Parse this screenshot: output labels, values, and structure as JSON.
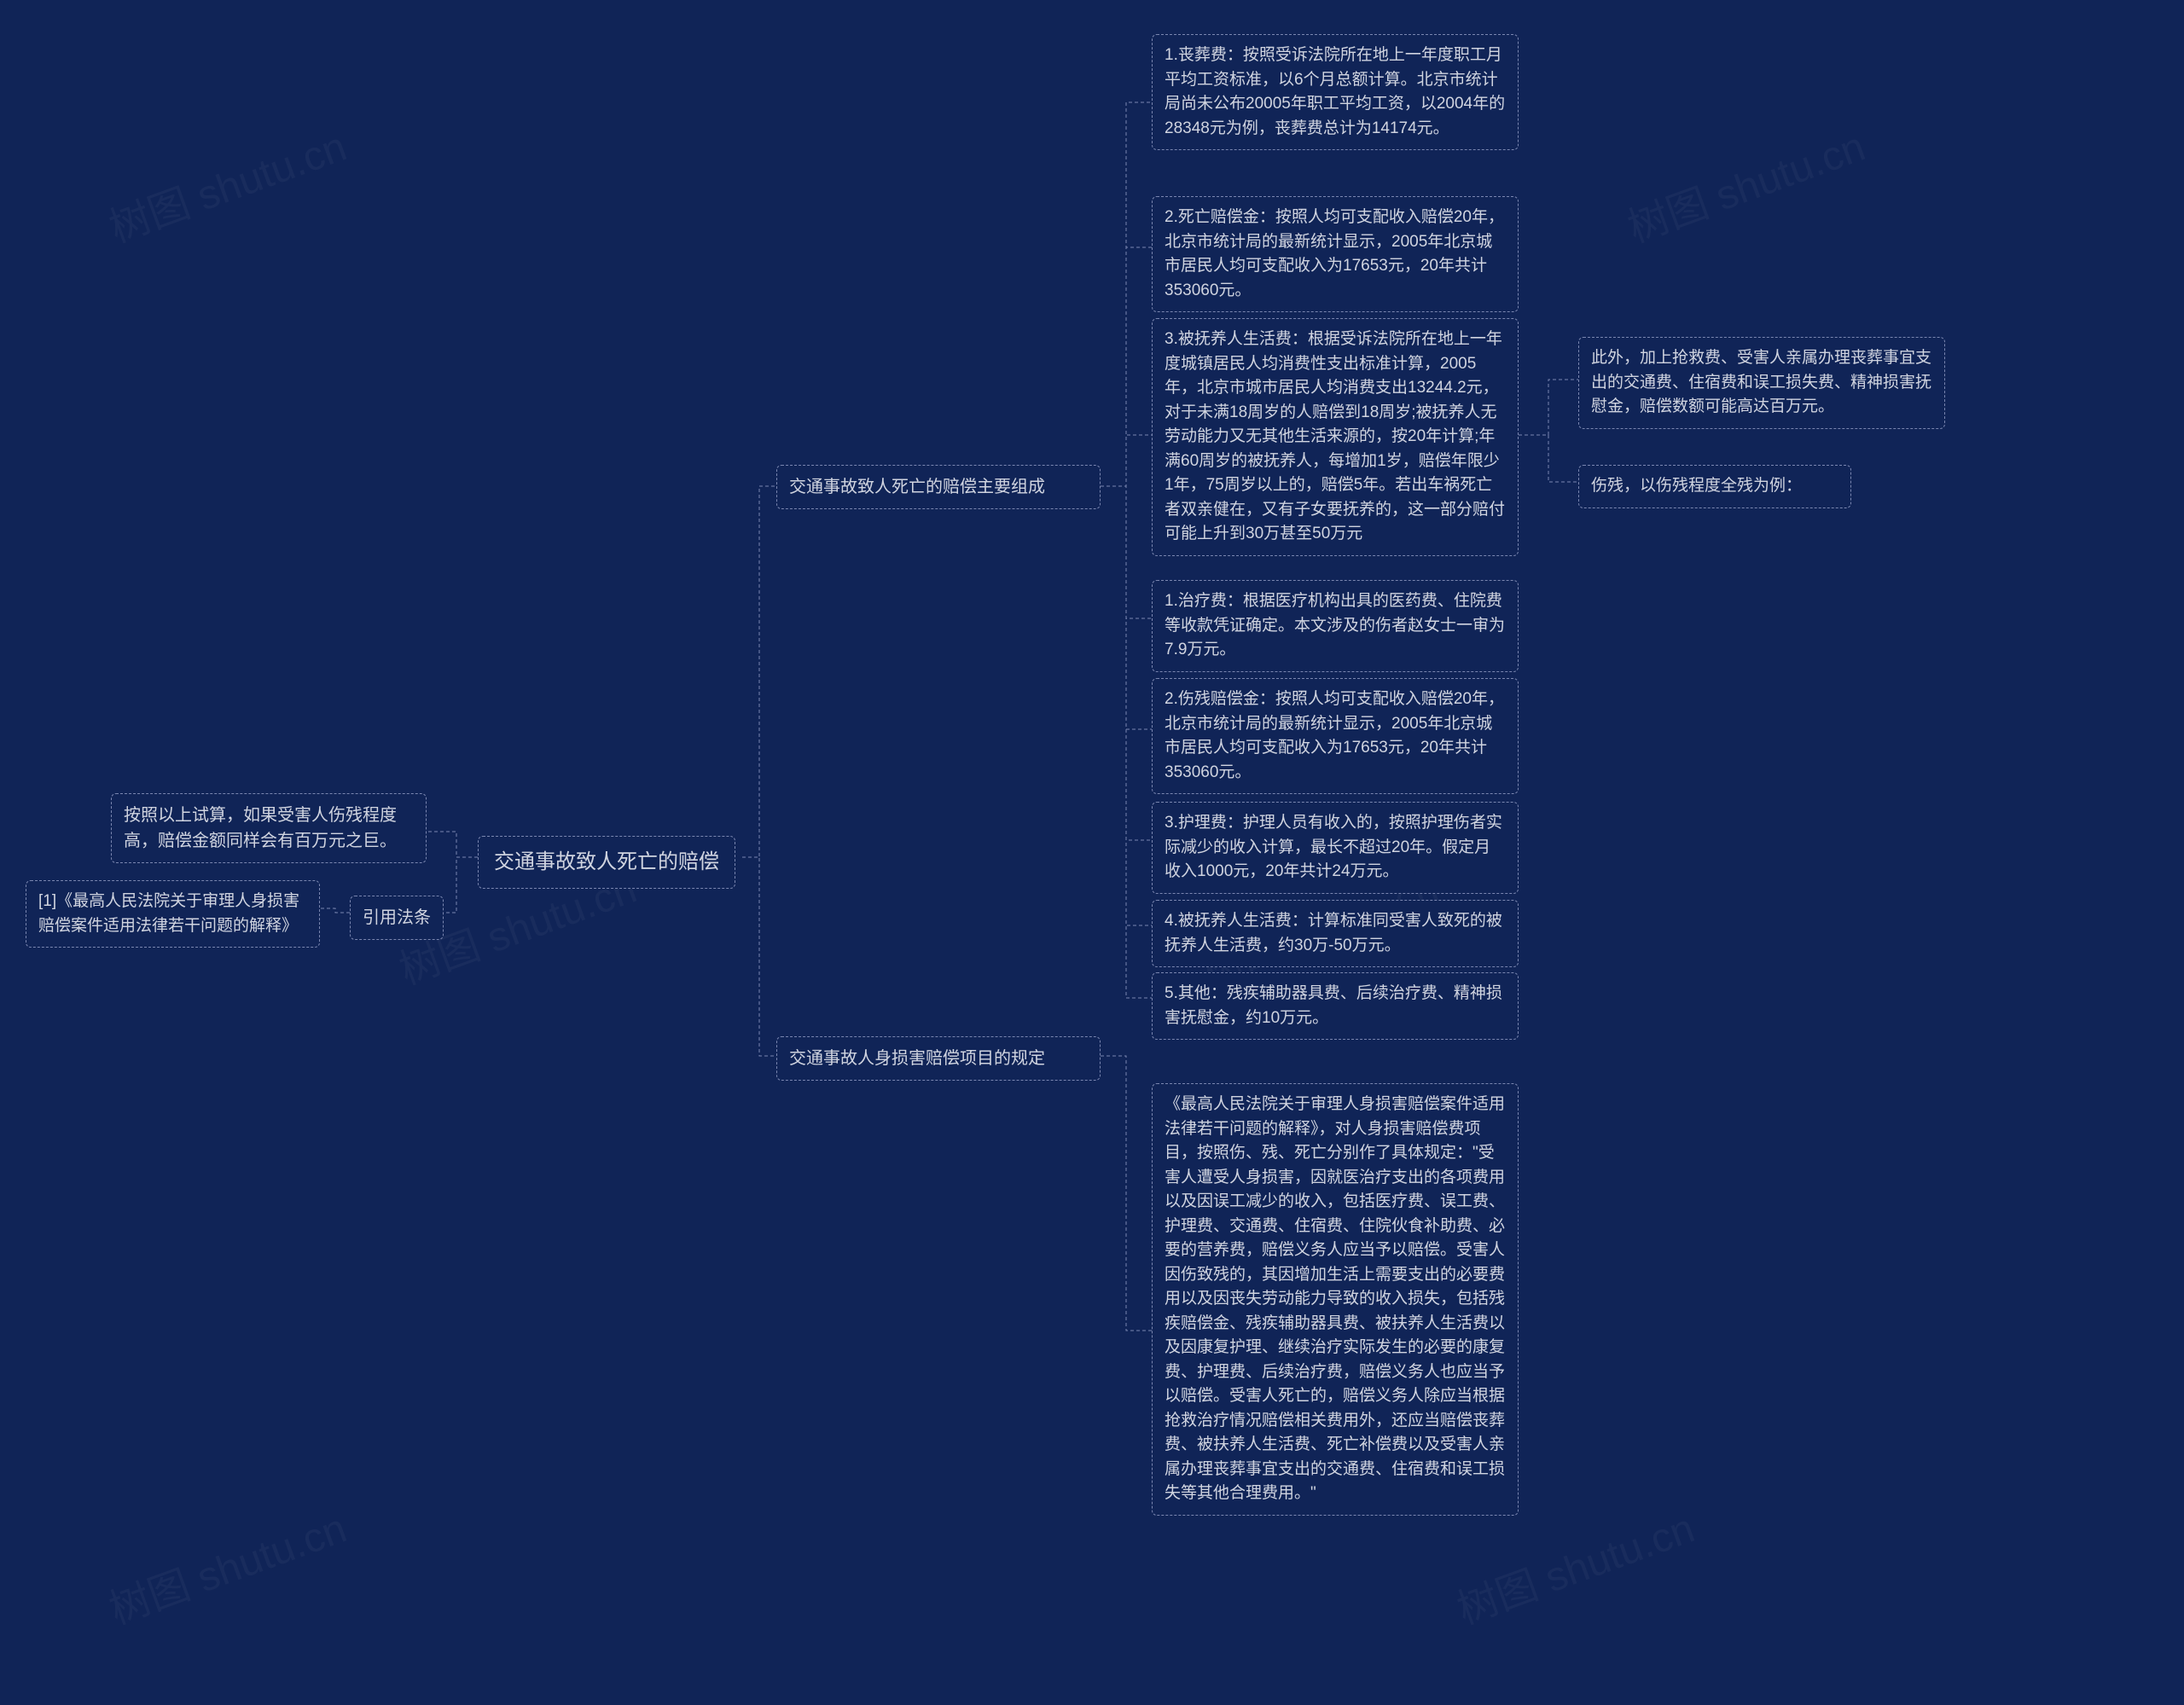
{
  "watermark": "树图 shutu.cn",
  "center": "交通事故致人死亡的赔偿",
  "left": {
    "note1": "按照以上试算，如果受害人伤残程度高，赔偿金额同样会有百万元之巨。",
    "cite_label": "引用法条",
    "cite_ref": "[1]《最高人民法院关于审理人身损害赔偿案件适用法律若干问题的解释》"
  },
  "right": {
    "composition_label": "交通事故致人死亡的赔偿主要组成",
    "items": [
      "1.丧葬费：按照受诉法院所在地上一年度职工月平均工资标准，以6个月总额计算。北京市统计局尚未公布20005年职工平均工资，以2004年的28348元为例，丧葬费总计为14174元。",
      "2.死亡赔偿金：按照人均可支配收入赔偿20年，北京市统计局的最新统计显示，2005年北京城市居民人均可支配收入为17653元，20年共计353060元。",
      "3.被抚养人生活费：根据受诉法院所在地上一年度城镇居民人均消费性支出标准计算，2005年，北京市城市居民人均消费支出13244.2元，对于未满18周岁的人赔偿到18周岁;被抚养人无劳动能力又无其他生活来源的，按20年计算;年满60周岁的被抚养人，每增加1岁，赔偿年限少1年，75周岁以上的，赔偿5年。若出车祸死亡者双亲健在，又有子女要抚养的，这一部分赔付可能上升到30万甚至50万元",
      "1.治疗费：根据医疗机构出具的医药费、住院费等收款凭证确定。本文涉及的伤者赵女士一审为7.9万元。",
      "2.伤残赔偿金：按照人均可支配收入赔偿20年，北京市统计局的最新统计显示，2005年北京城市居民人均可支配收入为17653元，20年共计353060元。",
      "3.护理费：护理人员有收入的，按照护理伤者实际减少的收入计算，最长不超过20年。假定月收入1000元，20年共计24万元。",
      "4.被抚养人生活费：计算标准同受害人致死的被抚养人生活费，约30万-50万元。",
      "5.其他：残疾辅助器具费、后续治疗费、精神损害抚慰金，约10万元。"
    ],
    "extra1": "此外，加上抢救费、受害人亲属办理丧葬事宜支出的交通费、住宿费和误工损失费、精神损害抚慰金，赔偿数额可能高达百万元。",
    "extra2": "伤残，以伤残程度全残为例：",
    "provision_label": "交通事故人身损害赔偿项目的规定",
    "provision_text": "《最高人民法院关于审理人身损害赔偿案件适用法律若干问题的解释》，对人身损害赔偿费项目，按照伤、残、死亡分别作了具体规定：\"受害人遭受人身损害，因就医治疗支出的各项费用以及因误工减少的收入，包括医疗费、误工费、护理费、交通费、住宿费、住院伙食补助费、必要的营养费，赔偿义务人应当予以赔偿。受害人因伤致残的，其因增加生活上需要支出的必要费用以及因丧失劳动能力导致的收入损失，包括残疾赔偿金、残疾辅助器具费、被扶养人生活费以及因康复护理、继续治疗实际发生的必要的康复费、护理费、后续治疗费，赔偿义务人也应当予以赔偿。受害人死亡的，赔偿义务人除应当根据抢救治疗情况赔偿相关费用外，还应当赔偿丧葬费、被扶养人生活费、死亡补偿费以及受害人亲属办理丧葬事宜支出的交通费、住宿费和误工损失等其他合理费用。\""
  }
}
